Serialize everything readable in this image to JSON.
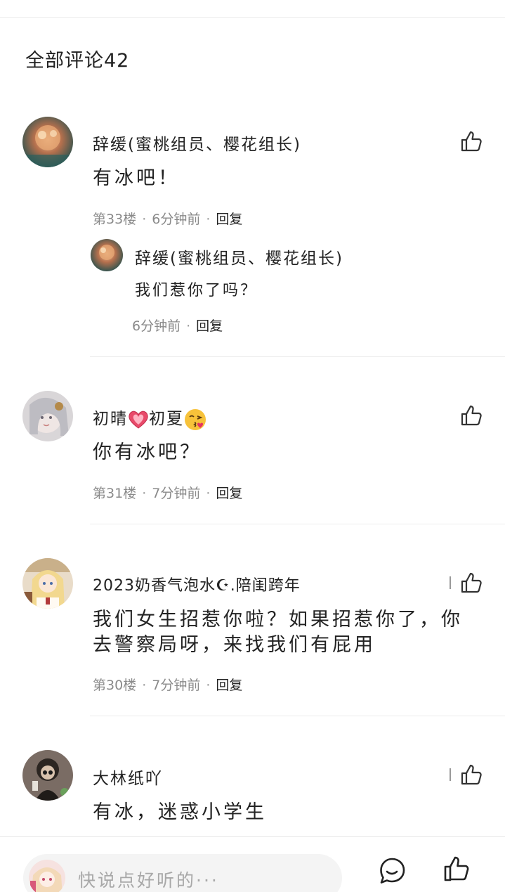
{
  "section": {
    "title": "全部评论42"
  },
  "comments": [
    {
      "username": "辞缓(蜜桃组员、樱花组长)",
      "content": "有冰吧！",
      "floor": "第33楼",
      "time": "6分钟前",
      "reply": "回复",
      "sub_reply": {
        "username": "辞缓(蜜桃组员、樱花组长)",
        "content": "我们惹你了吗？",
        "time": "6分钟前",
        "reply": "回复"
      }
    },
    {
      "username_pre": "初晴",
      "username_mid": "初夏",
      "content": "你有冰吧？",
      "floor": "第31楼",
      "time": "7分钟前",
      "reply": "回复"
    },
    {
      "username": "2023奶香气泡水☪.陪闺跨年",
      "content_line1": "我们女生招惹你啦？如果招惹你了，你",
      "content_line2": "去警察局呀，来找我们有屁用",
      "floor": "第30楼",
      "time": "7分钟前",
      "reply": "回复"
    },
    {
      "username": "大林纸吖",
      "content": "有冰，迷惑小学生"
    }
  ],
  "bottom_bar": {
    "input_placeholder": "快说点好听的···"
  },
  "colors": {
    "text": "#222222",
    "muted": "#8a8a8a",
    "divider": "#ececec",
    "input_bg": "#f4f4f4"
  },
  "icons": [
    "thumbs-up-icon",
    "comment-bubble-icon",
    "heart-emoji",
    "kiss-emoji"
  ]
}
